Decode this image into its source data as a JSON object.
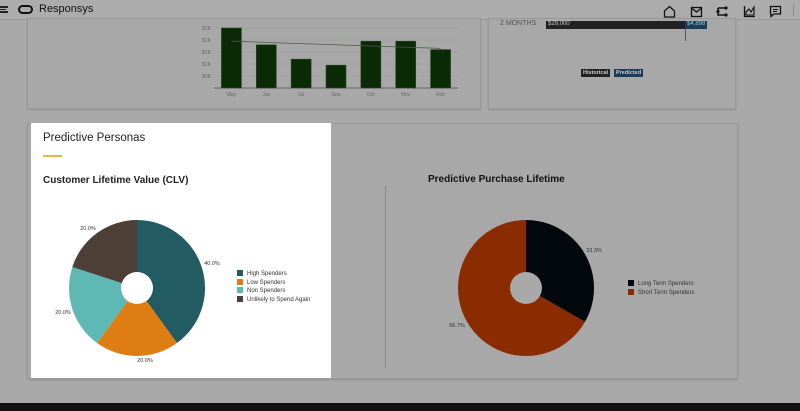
{
  "header": {
    "app_title": "Responsys",
    "icons": [
      "menu-icon",
      "home-icon",
      "mail-icon",
      "journey-icon",
      "analytics-icon",
      "messages-icon"
    ]
  },
  "top_left_card": {
    "chart_data": {
      "type": "bar",
      "categories": [
        "May",
        "Jun",
        "Jul",
        "Sep",
        "Oct",
        "Nov",
        "Feb"
      ],
      "values": [
        5.0,
        3.6,
        2.4,
        1.9,
        3.9,
        3.9,
        3.2
      ],
      "trend": [
        3.9,
        3.3
      ],
      "ytick_labels": [
        "$2K",
        "$2K",
        "$1K",
        "$1K",
        "$1K",
        "$0K"
      ],
      "ylim": [
        0,
        6
      ],
      "color": "#0b2a06"
    }
  },
  "top_right_card": {
    "row_label": "2 MONTHS",
    "historical_value": "$29,000",
    "predicted_value": "$4,898",
    "legend": {
      "historical": "Historical",
      "predicted": "Predicted"
    }
  },
  "personas": {
    "title": "Predictive Personas",
    "clv": {
      "title": "Customer Lifetime Value (CLV)",
      "chart_data": {
        "type": "pie",
        "labels": [
          "High Spenders",
          "Low Spenders",
          "Non Spenders",
          "Unlikely to Spend Again"
        ],
        "values": [
          40,
          20,
          20,
          20
        ],
        "value_labels": [
          "40.0%",
          "20.0%",
          "20.0%",
          "20.0%"
        ],
        "colors": [
          "#225b62",
          "#de7e12",
          "#5eb9b5",
          "#4b3f36"
        ]
      }
    },
    "ppl": {
      "title": "Predictive Purchase Lifetime",
      "chart_data": {
        "type": "pie",
        "labels": [
          "Long Term Spenders",
          "Short Term Spenders"
        ],
        "values": [
          33.3,
          66.7
        ],
        "value_labels": [
          "33.3%",
          "66.7%"
        ],
        "colors": [
          "#03080d",
          "#8a2b00"
        ]
      }
    }
  }
}
